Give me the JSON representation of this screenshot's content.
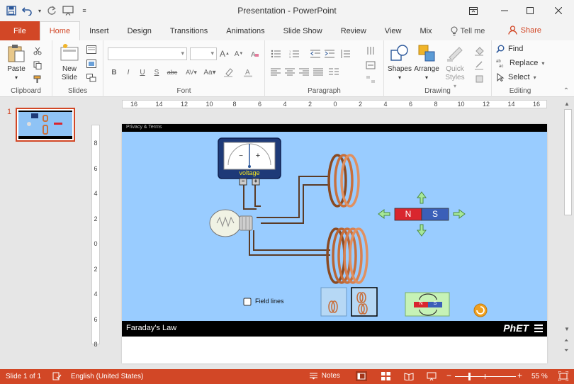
{
  "window": {
    "title": "Presentation - PowerPoint",
    "controls": [
      "restore-ribbon",
      "minimize",
      "maximize",
      "close"
    ]
  },
  "tabs": [
    {
      "label": "File"
    },
    {
      "label": "Home"
    },
    {
      "label": "Insert"
    },
    {
      "label": "Design"
    },
    {
      "label": "Transitions"
    },
    {
      "label": "Animations"
    },
    {
      "label": "Slide Show"
    },
    {
      "label": "Review"
    },
    {
      "label": "View"
    },
    {
      "label": "Mix"
    }
  ],
  "tell_me": "Tell me",
  "share": "Share",
  "ribbon": {
    "clipboard": {
      "label": "Clipboard",
      "paste": "Paste"
    },
    "slides": {
      "label": "Slides",
      "new_slide": "New Slide"
    },
    "font": {
      "label": "Font"
    },
    "paragraph": {
      "label": "Paragraph"
    },
    "drawing": {
      "label": "Drawing",
      "shapes": "Shapes",
      "arrange": "Arrange",
      "quick_styles": "Quick Styles"
    },
    "editing": {
      "label": "Editing",
      "find": "Find",
      "replace": "Replace",
      "select": "Select"
    },
    "font_buttons": [
      "B",
      "I",
      "U",
      "S",
      "abc"
    ]
  },
  "thumbnail": {
    "number": "1"
  },
  "ruler_h": [
    "16",
    "14",
    "12",
    "10",
    "8",
    "6",
    "4",
    "2",
    "0",
    "2",
    "4",
    "6",
    "8",
    "10",
    "12",
    "14",
    "16"
  ],
  "ruler_v": [
    "8",
    "6",
    "4",
    "2",
    "0",
    "2",
    "4",
    "6",
    "8"
  ],
  "sim": {
    "privacy": "Privacy & Terms",
    "title": "Faraday's Law",
    "voltage": "voltage",
    "minus": "−",
    "plus": "+",
    "field_lines": "Field lines",
    "magnet_n": "N",
    "magnet_s": "S",
    "logo": "PhET"
  },
  "status": {
    "slide": "Slide 1 of 1",
    "language": "English (United States)",
    "notes": "Notes",
    "zoom": "55 %"
  },
  "colors": {
    "accent": "#d24726",
    "sim_bg": "#99ccff",
    "coil": "#c8703c",
    "magnet_n": "#d9262e",
    "magnet_s": "#3b5fb8"
  }
}
